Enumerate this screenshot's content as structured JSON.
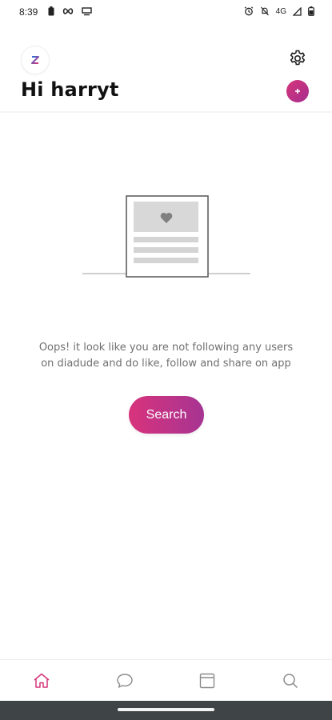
{
  "status_bar": {
    "time": "8:39",
    "network": "4G"
  },
  "header": {
    "logo_letter": "z",
    "greeting": "Hi harryt"
  },
  "empty_state": {
    "line1": "Oops! it look like you are not following any users",
    "line2": "on diadude and do like, follow and share on app",
    "button_label": "Search"
  },
  "bottom_nav": {
    "items": [
      {
        "icon": "home-icon",
        "active": true
      },
      {
        "icon": "chat-icon",
        "active": false
      },
      {
        "icon": "window-icon",
        "active": false
      },
      {
        "icon": "search-icon",
        "active": false
      }
    ]
  },
  "colors": {
    "accent": "#d6357a",
    "accent_dark": "#a63492"
  }
}
